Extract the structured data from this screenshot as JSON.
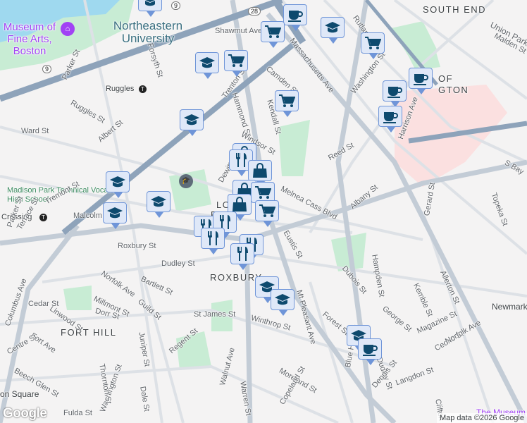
{
  "map": {
    "neighborhoods": [
      "SOUTH END",
      "FORT HILL",
      "ROXBURY",
      "LO",
      "R"
    ],
    "pois": {
      "museum": "Museum of Fine Arts, Boston",
      "university": "Northeastern University",
      "high_school": "Madison Park Technical Vocational High School",
      "ruggles": "Ruggles",
      "crossing": "Crossing",
      "medical": "OF GTON",
      "newmarket": "Newmarket",
      "museum2": "The Museum",
      "hedge": "Union Park",
      "dudley_sq": "on Square"
    },
    "route_shields": [
      "9",
      "9",
      "28"
    ],
    "streets": [
      "Ruggles St",
      "Parker St",
      "Forsyth St",
      "Ward St",
      "Albert St",
      "Tremont St",
      "Trenton St",
      "Hammond St",
      "Camden St",
      "Kendall St",
      "Windsor St",
      "Dewitt Dr",
      "Massachusetts Ave",
      "Washington St",
      "Rutland St",
      "Malden St",
      "Reed St",
      "Melnea Cass Blvd",
      "Albany St",
      "Harrison Ave",
      "S Bay",
      "Topeka St",
      "Malcolm X Blvd",
      "Roxbury St",
      "Dudley St",
      "Norfolk Ave",
      "Bartlett St",
      "Linwood St",
      "Millmont St",
      "Dorr St",
      "Guild St",
      "Cedar St",
      "Fort Ave",
      "Centre St",
      "Beech Glen St",
      "Juniper St",
      "Regent St",
      "St James St",
      "Winthrop St",
      "Moreland St",
      "Warren St",
      "Eustis St",
      "Mt Pleasant Ave",
      "Hampden St",
      "Dubois St",
      "Gerard St",
      "Kemble St",
      "Allerton St",
      "George St",
      "Magazine St",
      "Cedric St",
      "Forest St",
      "Blue Hill Ave",
      "Dudley St",
      "Langdon St",
      "Dennis St",
      "Clifton",
      "Walnut Ave",
      "Washington St",
      "Thornton St",
      "Dale St",
      "Fulda St",
      "Copeland St",
      "Columbus Ave",
      "Terrace St",
      "Parker St",
      "Shawmut Ave",
      "Norfolk Ave"
    ],
    "markers": [
      "edu",
      "coffee",
      "cart",
      "edu",
      "cart",
      "edu",
      "cart",
      "coffee",
      "coffee",
      "cart",
      "coffee",
      "edu",
      "bag",
      "food",
      "bag",
      "bag",
      "cart",
      "edu",
      "edu",
      "edu",
      "bag",
      "cart",
      "food",
      "food",
      "food",
      "food",
      "food",
      "edu",
      "edu",
      "edu",
      "coffee"
    ],
    "attribution": "Map data ©2026 Google",
    "logo": "Google"
  },
  "colors": {
    "marker_icon": "#0e4a6e",
    "marker_bg": "#dfe8f8",
    "marker_border": "#6f95d8",
    "park": "#c6ecd3",
    "highway": "#8ea3ba"
  }
}
